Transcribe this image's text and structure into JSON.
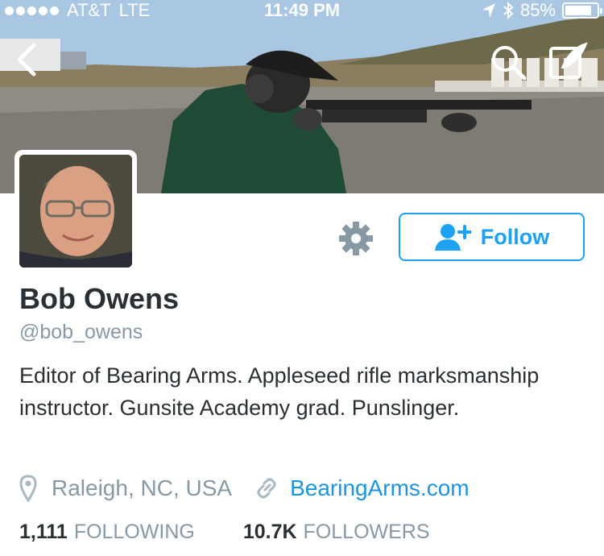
{
  "status_bar": {
    "carrier": "AT&T",
    "network": "LTE",
    "time": "11:49 PM",
    "battery_percent": "85%",
    "battery_level": 0.85,
    "signal_bars": 5
  },
  "profile": {
    "display_name": "Bob Owens",
    "handle": "@bob_owens",
    "bio": "Editor of Bearing Arms. Appleseed rifle marksmanship instructor. Gunsite Academy grad. Punslinger.",
    "location": "Raleigh, NC, USA",
    "website": "BearingArms.com"
  },
  "actions": {
    "follow_label": "Follow"
  },
  "stats": {
    "following_count": "1,111",
    "following_label": "FOLLOWING",
    "followers_count": "10.7K",
    "followers_label": "FOLLOWERS"
  },
  "icons": {
    "back": "back-chevron-icon",
    "search": "search-icon",
    "compose": "compose-icon",
    "settings": "gear-icon",
    "follow": "add-user-icon",
    "location": "location-pin-icon",
    "link": "link-icon"
  },
  "colors": {
    "accent": "#1da1f2",
    "link": "#1b95e0",
    "text": "#292f33",
    "muted": "#8899a6",
    "gear": "#8899a6"
  }
}
